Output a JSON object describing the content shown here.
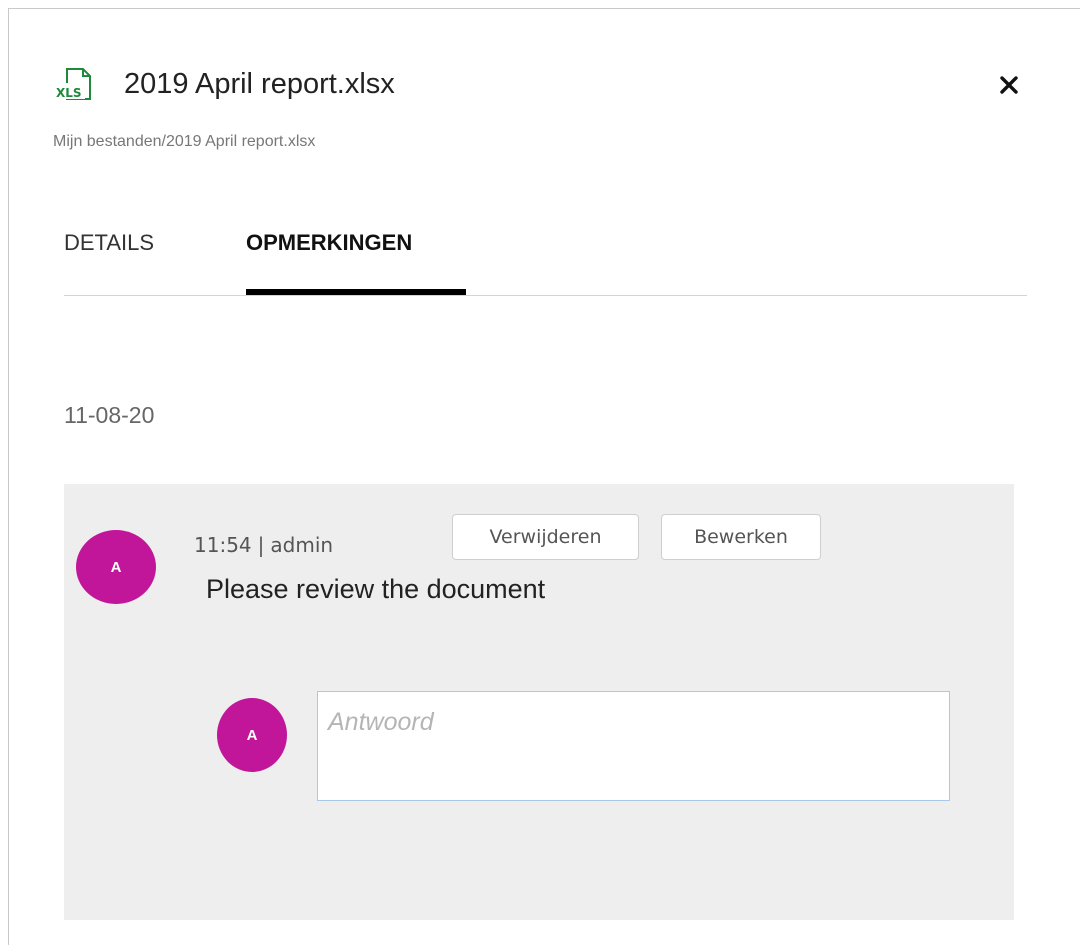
{
  "header": {
    "file_icon": "xls-file-icon",
    "file_icon_text": "XLS",
    "title": "2019 April report.xlsx",
    "path": "Mijn bestanden/2019 April report.xlsx",
    "close_icon": "close-icon"
  },
  "tabs": [
    {
      "label": "DETAILS",
      "active": false
    },
    {
      "label": "OPMERKINGEN",
      "active": true
    }
  ],
  "comments": {
    "date": "11-08-20",
    "items": [
      {
        "avatar_initial": "A",
        "time": "11:54",
        "separator": "|",
        "author": "admin",
        "delete_label": "Verwijderen",
        "edit_label": "Bewerken",
        "text": "Please review the document"
      }
    ],
    "reply": {
      "avatar_initial": "A",
      "placeholder": "Antwoord",
      "value": ""
    }
  },
  "colors": {
    "avatar": "#c1169a",
    "card_background": "#eeeeee",
    "active_tab_underline": "#000000",
    "excel_green": "#1d8a3a",
    "input_border": "#a9c9ea"
  }
}
